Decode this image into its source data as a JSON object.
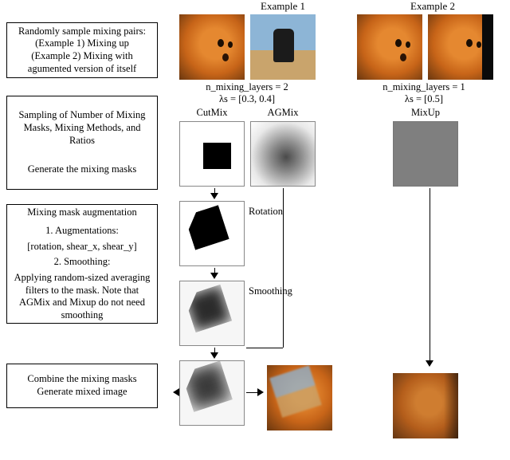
{
  "headers": {
    "example1": "Example 1",
    "example2": "Example 2"
  },
  "boxes": {
    "step1": "Randomly sample mixing pairs:\n(Example 1) Mixing up\n(Example 2) Mixing with\nagumented version of itself",
    "step2a": "Sampling of Number of Mixing Masks, Mixing Methods, and Ratios",
    "step2b": "Generate the mixing masks",
    "step3_title": "Mixing mask augmentation",
    "step3_l1": "1. Augmentations:",
    "step3_l2": "[rotation, shear_x, shear_y]",
    "step3_l3": "2. Smoothing:",
    "step3_l4": "Applying random-sized averaging filters to the mask. Note that AGMix and Mixup do not need smoothing",
    "step4a": "Combine the mixing masks",
    "step4b": "Generate mixed image"
  },
  "params": {
    "ex1_layers": "n_mixing_layers = 2",
    "ex1_lambda": "λs = [0.3, 0.4]",
    "ex2_layers": "n_mixing_layers = 1",
    "ex2_lambda": "λs = [0.5]"
  },
  "methods": {
    "cutmix": "CutMix",
    "agmix": "AGMix",
    "mixup": "MixUp"
  },
  "ops": {
    "rotation": "Rotation",
    "smoothing": "Smoothing"
  },
  "chart_data": {
    "type": "table",
    "title": "MixMix augmentation pipeline — two examples",
    "examples": [
      {
        "name": "Example 1",
        "pair": [
          "original image (fox)",
          "second image (dog)"
        ],
        "n_mixing_layers": 2,
        "lambdas": [
          0.3,
          0.4
        ],
        "mixing_methods": [
          "CutMix",
          "AGMix"
        ],
        "mask_augmentations": [
          "rotation",
          "shear_x",
          "shear_y"
        ],
        "smoothing_applied": true,
        "output": "mixed image (fox + dog, warped mask)"
      },
      {
        "name": "Example 2",
        "pair": [
          "original image (fox)",
          "augmented version of itself (cropped fox)"
        ],
        "n_mixing_layers": 1,
        "lambdas": [
          0.5
        ],
        "mixing_methods": [
          "MixUp"
        ],
        "mask_augmentations": [],
        "smoothing_applied": false,
        "output": "mixed image (fox self-blend)"
      }
    ],
    "pipeline_steps": [
      "Randomly sample mixing pairs",
      "Sample number of mixing masks, mixing methods, and ratios; generate masks",
      "Mixing mask augmentation (rotation / shear) + smoothing",
      "Combine mixing masks and generate mixed image"
    ]
  }
}
